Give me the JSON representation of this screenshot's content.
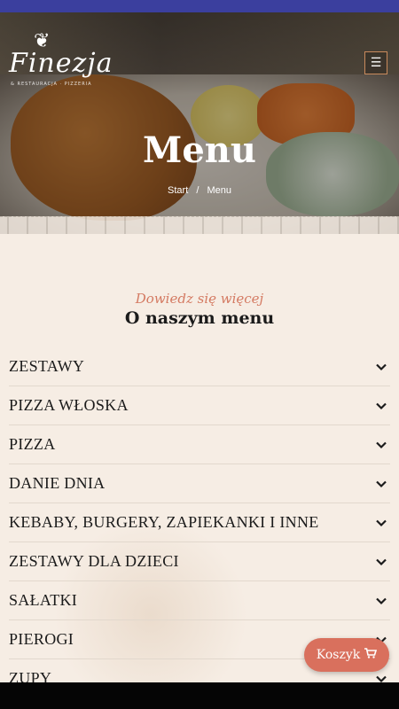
{
  "brand": {
    "logo_text": "Finezja",
    "logo_tagline": "& RESTAURACJA · PIZZERIA"
  },
  "hero": {
    "title": "Menu",
    "breadcrumb": [
      "Start",
      "Menu"
    ],
    "separator": "/"
  },
  "section": {
    "subtitle": "Dowiedz się więcej",
    "title": "O naszym menu"
  },
  "menu_categories": [
    "ZESTAWY",
    "PIZZA WŁOSKA",
    "PIZZA",
    "DANIE DNIA",
    "KEBABY, BURGERY, ZAPIEKANKI I INNE",
    "ZESTAWY DLA DZIECI",
    "SAŁATKI",
    "PIEROGI",
    "ZUPY"
  ],
  "cart": {
    "label": "Koszyk",
    "icon": "cart-icon"
  },
  "colors": {
    "topbar": "#3b3f9e",
    "accent": "#d9705d",
    "subtitle": "#d47a62",
    "background": "#f6ede4"
  }
}
